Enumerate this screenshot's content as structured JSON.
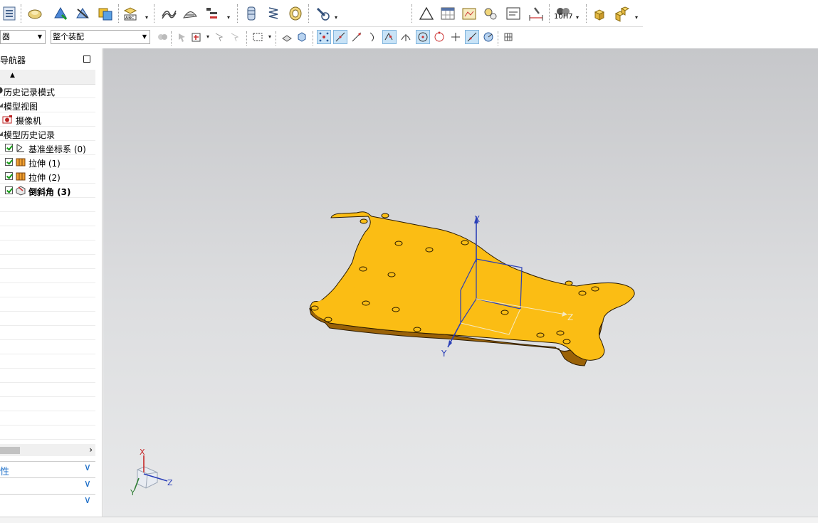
{
  "toolbar_secondary": {
    "selection_filter": "器",
    "assembly_scope": "整个装配"
  },
  "toolbar_main": {
    "hole_fit_label": "10H7"
  },
  "navigator": {
    "title": "导航器",
    "sort_indicator": "▲",
    "items": [
      {
        "label": "历史记录模式"
      },
      {
        "label": "模型视图"
      },
      {
        "label": "摄像机"
      },
      {
        "label": "模型历史记录"
      },
      {
        "label": "基准坐标系 (0)"
      },
      {
        "label": "拉伸 (1)"
      },
      {
        "label": "拉伸 (2)"
      },
      {
        "label": "倒斜角 (3)"
      }
    ],
    "panels": [
      {
        "label": "性"
      },
      {
        "label": ""
      },
      {
        "label": ""
      }
    ]
  },
  "viewport": {
    "axis_labels": {
      "x": "X",
      "y": "Y",
      "z": "Z"
    },
    "triad_labels": {
      "x": "X",
      "y": "Y",
      "z": "Z"
    },
    "part_color": "#fbbd14",
    "part_edge_color": "#2a1a00",
    "wcs_color": "#2a3fb8"
  },
  "icons": [
    "assembly-nav-icon",
    "constraints-icon",
    "surface-icon",
    "wave-icon",
    "add-component-icon",
    "move-component-icon",
    "triangle-sketch-icon",
    "table-icon",
    "camera-icon",
    "hose-icon",
    "spring-icon",
    "bearing-icon",
    "rotate-icon",
    "parts-list-icon"
  ]
}
